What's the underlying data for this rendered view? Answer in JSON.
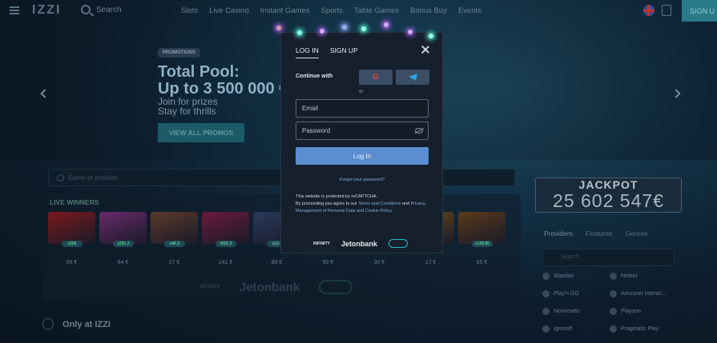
{
  "header": {
    "logo": "IZZI",
    "search_label": "Search",
    "nav": [
      "Slots",
      "Live Casino",
      "Instant Games",
      "Sports",
      "Table Games",
      "Bonus Buy",
      "Events"
    ],
    "signup_label": "SIGN U"
  },
  "hero": {
    "badge": "PROMOTIONS",
    "title_line1": "Total Pool:",
    "title_line2": "Up to 3 500 000 €",
    "sub_line1": "Join for prizes",
    "sub_line2": "Stay for thrills",
    "cta": "VIEW ALL PROMOS"
  },
  "games_search": {
    "placeholder": "Game or provider"
  },
  "live_winners": {
    "title": "LIVE WINNERS",
    "items": [
      {
        "badge": "x205",
        "amount": "66 €",
        "color": "#7a1a1a"
      },
      {
        "badge": "x291.2",
        "amount": "64 €",
        "color": "#6a2a6a"
      },
      {
        "badge": "x46.2",
        "amount": "27 €",
        "color": "#5a3a2a"
      },
      {
        "badge": "x601.3",
        "amount": "141 €",
        "color": "#6a1a3a"
      },
      {
        "badge": "x12.4",
        "amount": "80 €",
        "color": "#2a3a5a"
      },
      {
        "badge": "",
        "amount": "90 €",
        "color": "#3a2a4a"
      },
      {
        "badge": "",
        "amount": "30 €",
        "color": "#2a4a4a"
      },
      {
        "badge": "",
        "amount": "17 €",
        "color": "#6a4a1a"
      },
      {
        "badge": "x128.85",
        "amount": "55 €",
        "color": "#5a3a1a"
      }
    ]
  },
  "partners": {
    "infinity": "INFINITY",
    "jetonbank": "Jetonbank"
  },
  "only_at": "Only at IZZI",
  "jackpot": {
    "title": "JACKPOT",
    "value": "25 602 547€"
  },
  "providers": {
    "tabs": [
      "Providers",
      "Features",
      "Genres"
    ],
    "search_placeholder": "Search",
    "items": [
      "Wazdan",
      "Netent",
      "Play'n GO",
      "Amusnet Interac...",
      "Novomatic",
      "Playson",
      "Igrosoft",
      "Pragmatic Play"
    ]
  },
  "modal": {
    "tab_login": "LOG IN",
    "tab_signup": "SIGN UP",
    "continue_with": "Continue with",
    "google": "G",
    "or": "or",
    "email_placeholder": "Email",
    "password_placeholder": "Password",
    "login_button": "Log In",
    "forgot": "Forgot your password?",
    "legal_1": "This website is protected by reCAPTCHA.",
    "legal_2": "By proceeding you agree to our ",
    "legal_link1": "Terms and Conditions",
    "legal_3": " and ",
    "legal_link2": "Privacy",
    "legal_4": ", ",
    "legal_link3": "Management of Personal Data and Cookie Policy",
    "legal_5": ".",
    "logo_infinity": "INFINITY",
    "logo_jetonbank": "Jetonbank"
  },
  "colors": {
    "accent": "#5a8ed0",
    "modal_bg": "#161f2c",
    "link": "#7fb0e0"
  }
}
